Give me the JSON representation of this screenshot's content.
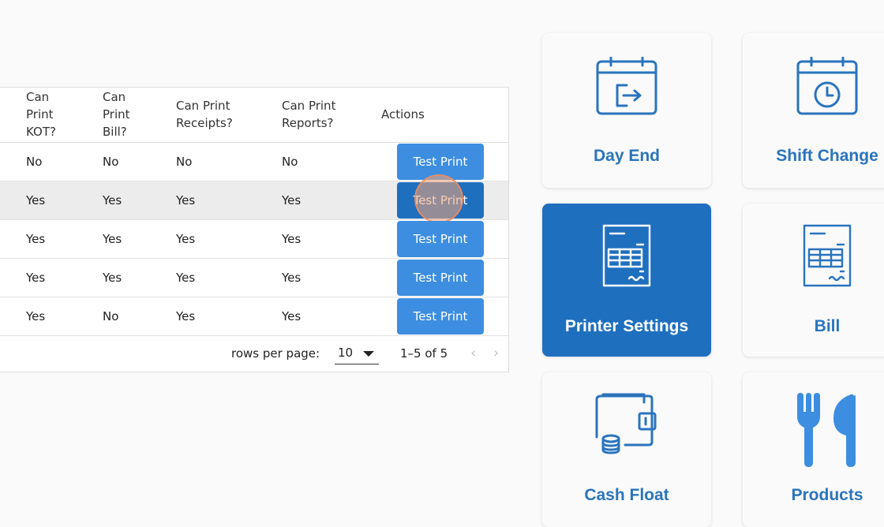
{
  "table": {
    "headers": {
      "kot": [
        "Can",
        "Print",
        "KOT?"
      ],
      "bill": [
        "Can",
        "Print",
        "Bill?"
      ],
      "receipts": [
        "Can Print",
        "Receipts?"
      ],
      "reports": [
        "Can Print",
        "Reports?"
      ],
      "actions": "Actions"
    },
    "rows": [
      {
        "kot": "No",
        "bill": "No",
        "receipts": "No",
        "reports": "No",
        "action": "Test Print"
      },
      {
        "kot": "Yes",
        "bill": "Yes",
        "receipts": "Yes",
        "reports": "Yes",
        "action": "Test Print"
      },
      {
        "kot": "Yes",
        "bill": "Yes",
        "receipts": "Yes",
        "reports": "Yes",
        "action": "Test Print"
      },
      {
        "kot": "Yes",
        "bill": "Yes",
        "receipts": "Yes",
        "reports": "Yes",
        "action": "Test Print"
      },
      {
        "kot": "Yes",
        "bill": "No",
        "receipts": "Yes",
        "reports": "Yes",
        "action": "Test Print"
      }
    ],
    "pagination": {
      "rows_per_page_label": "rows per page:",
      "rows_per_page_value": "10",
      "range": "1–5 of 5",
      "prev": "‹",
      "next": "›"
    }
  },
  "tiles": [
    {
      "label": "Day End",
      "icon": "calendar-exit-icon"
    },
    {
      "label": "Shift Change",
      "icon": "calendar-clock-icon"
    },
    {
      "label": "Printer Settings",
      "icon": "printer-settings-icon",
      "active": true
    },
    {
      "label": "Bill",
      "icon": "bill-icon"
    },
    {
      "label": "Cash Float",
      "icon": "wallet-coins-icon"
    },
    {
      "label": "Products",
      "icon": "fork-knife-icon"
    }
  ],
  "colors": {
    "primary_button": "#3d8ee0",
    "pressed_button": "#1f6fbf",
    "tile_active": "#1f6fbf",
    "tile_label": "#2a74bd",
    "click_indicator": "#f4a578"
  }
}
